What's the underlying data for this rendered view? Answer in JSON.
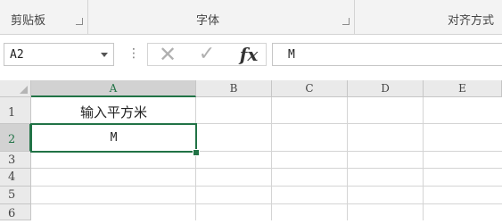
{
  "ribbon": {
    "groups": [
      {
        "label": "剪贴板"
      },
      {
        "label": "字体"
      },
      {
        "label": "对齐方式"
      }
    ]
  },
  "formula_bar": {
    "name_box": "A2",
    "fx_label": "fx",
    "cancel_icon": "cancel-x-icon",
    "enter_icon": "enter-check-icon",
    "formula_value": "M"
  },
  "sheet": {
    "columns": [
      "A",
      "B",
      "C",
      "D",
      "E"
    ],
    "rows": [
      "1",
      "2",
      "3",
      "4",
      "5",
      "6"
    ],
    "selected_cell": "A2",
    "cells": {
      "A1": "输入平方米",
      "A2": "M"
    },
    "accent_color": "#217346"
  }
}
